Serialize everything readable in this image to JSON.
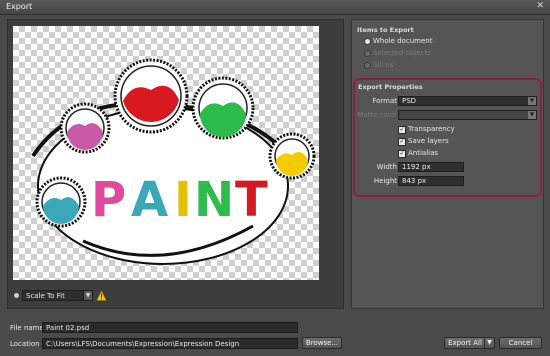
{
  "window": {
    "title": "Export",
    "close_glyph": "✕"
  },
  "preview": {
    "artwork_text": "PAINT",
    "letters": [
      {
        "char": "P",
        "color": "#e04a9a"
      },
      {
        "char": "A",
        "color": "#3aa8b8"
      },
      {
        "char": "I",
        "color": "#e6c000"
      },
      {
        "char": "N",
        "color": "#2dbb4b"
      },
      {
        "char": "T",
        "color": "#d61a20"
      }
    ],
    "scale_mode": "Scale To Fit",
    "warning_icon": "warning-icon"
  },
  "items_to_export": {
    "title": "Items to Export",
    "options": [
      {
        "label": "Whole document",
        "selected": true,
        "enabled": true
      },
      {
        "label": "Selected objects",
        "selected": false,
        "enabled": false
      },
      {
        "label": "Slices",
        "selected": false,
        "enabled": false
      }
    ]
  },
  "export_properties": {
    "title": "Export Properties",
    "format_label": "Format",
    "format_value": "PSD",
    "matte_label": "Matte color",
    "checkboxes": [
      {
        "label": "Transparency",
        "checked": true
      },
      {
        "label": "Save layers",
        "checked": true
      },
      {
        "label": "Antialias",
        "checked": true
      }
    ],
    "width_label": "Width",
    "width_value": "1192 px",
    "height_label": "Height",
    "height_value": "843 px",
    "highlight_color": "#8e1e48"
  },
  "file": {
    "name_label": "File name",
    "name_value": "Paint 02.psd",
    "location_label": "Location",
    "location_value": "C:\\Users\\LFS\\Documents\\Expression\\Expression Design",
    "browse_label": "Browse..."
  },
  "buttons": {
    "export_all": "Export All",
    "cancel": "Cancel"
  }
}
